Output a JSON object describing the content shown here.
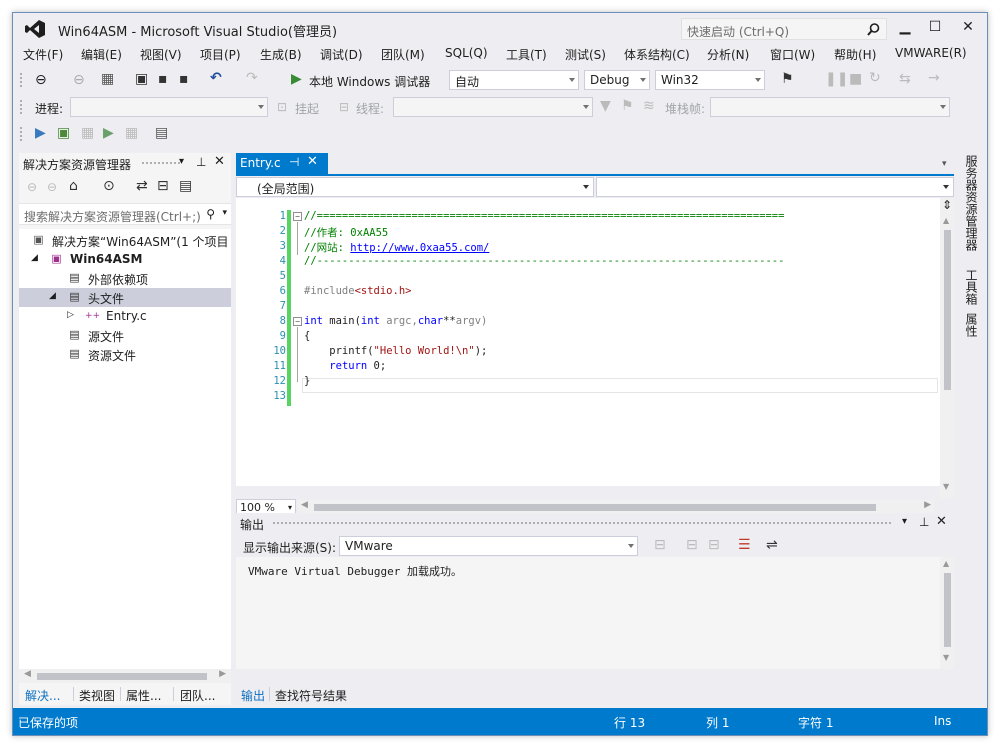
{
  "window": {
    "title": "Win64ASM - Microsoft Visual Studio(管理员)"
  },
  "quick_launch": {
    "placeholder": "快速启动 (Ctrl+Q)"
  },
  "menu": [
    "文件(F)",
    "编辑(E)",
    "视图(V)",
    "项目(P)",
    "生成(B)",
    "调试(D)",
    "团队(M)",
    "SQL(Q)",
    "工具(T)",
    "测试(S)",
    "体系结构(C)",
    "分析(N)",
    "窗口(W)",
    "帮助(H)",
    "VMWARE(R)"
  ],
  "toolbar": {
    "debugger_label": "本地 Windows 调试器",
    "auto": "自动",
    "config": "Debug",
    "platform": "Win32",
    "process_label": "进程:",
    "suspend_label": "挂起",
    "thread_label": "线程:",
    "stackframe_label": "堆栈帧:"
  },
  "solution_explorer": {
    "title": "解决方案资源管理器",
    "search_placeholder": "搜索解决方案资源管理器(Ctrl+;)",
    "tree": [
      {
        "label": "解决方案“Win64ASM”(1 个项目",
        "icon": "solution-icon"
      },
      {
        "label": "Win64ASM",
        "icon": "project-icon"
      },
      {
        "label": "外部依赖项",
        "icon": "external-deps-icon"
      },
      {
        "label": "头文件",
        "icon": "folder-filter-icon"
      },
      {
        "label": "Entry.c",
        "icon": "c-file-icon"
      },
      {
        "label": "源文件",
        "icon": "folder-filter-icon"
      },
      {
        "label": "资源文件",
        "icon": "folder-filter-icon"
      }
    ],
    "bottom_tabs": [
      "解决...",
      "类视图",
      "属性...",
      "团队..."
    ]
  },
  "editor": {
    "tab": "Entry.c",
    "scope": "(全局范围)",
    "line_numbers": [
      "1",
      "2",
      "3",
      "4",
      "5",
      "6",
      "7",
      "8",
      "9",
      "10",
      "11",
      "12",
      "13"
    ],
    "code": {
      "l1": "//==========================================================================",
      "l2_a": "//作者: ",
      "l2_b": "0xAA55",
      "l3_a": "//网站: ",
      "l3_b": "http://www.0xaa55.com/",
      "l4": "//--------------------------------------------------------------------------",
      "l6_a": "#include",
      "l6_b": "<stdio.h>",
      "l8_a": "int",
      "l8_b": " main(",
      "l8_c": "int",
      "l8_d": " argc,",
      "l8_e": "char",
      "l8_f": "**",
      "l8_g": "argv)",
      "l9": "{",
      "l10_a": "    printf(",
      "l10_b": "\"Hello World!\\n\"",
      "l10_c": ");",
      "l11_a": "    ",
      "l11_b": "return",
      "l11_c": " 0;",
      "l12": "}"
    },
    "zoom": "100 %"
  },
  "output": {
    "title": "输出",
    "source_label": "显示输出来源(S):",
    "source_value": "VMware",
    "text": "VMware Virtual Debugger 加载成功。",
    "tabs": [
      "输出",
      "查找符号结果"
    ]
  },
  "side_tabs": [
    "服务器资源管理器",
    "工具箱",
    "属性"
  ],
  "status": {
    "message": "已保存的项",
    "line": "行 13",
    "col": "列 1",
    "char": "字符 1",
    "mode": "Ins"
  },
  "colors": {
    "accent": "#007acc",
    "chrome": "#eeeef2",
    "line_number": "#2b91af",
    "comment": "#008000",
    "keyword": "#0000ff"
  }
}
